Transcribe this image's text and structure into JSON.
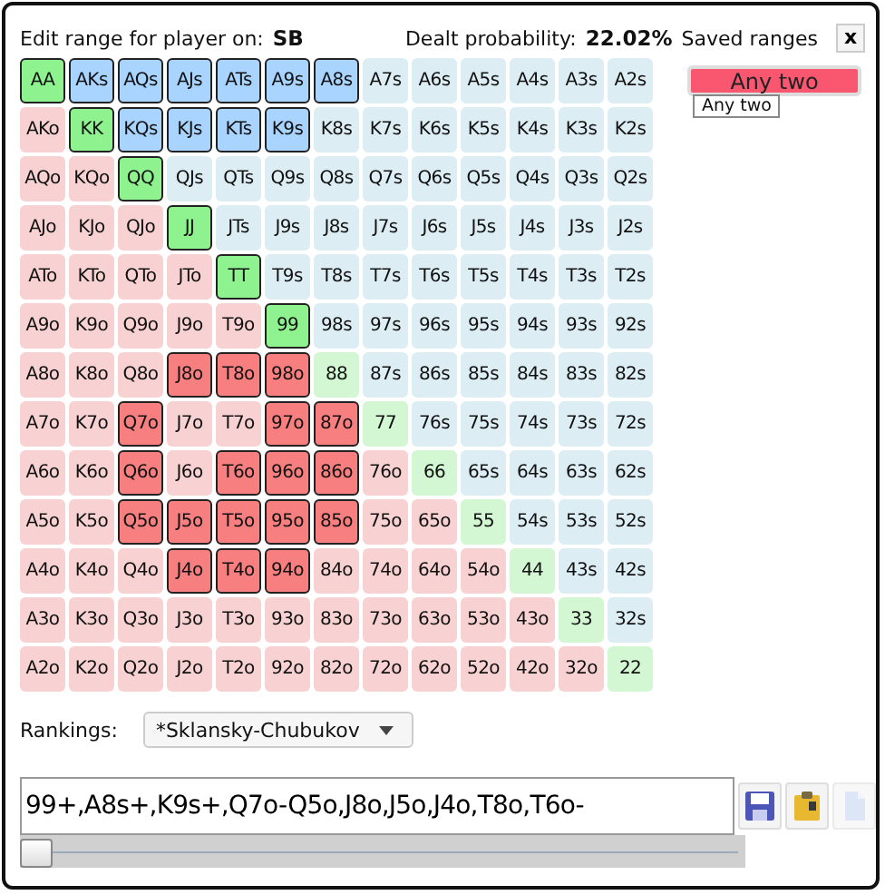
{
  "header": {
    "label": "Edit range for player on:",
    "player": "SB",
    "probability_label": "Dealt probability:",
    "probability": "22.02%"
  },
  "saved_ranges": {
    "title": "Saved ranges",
    "close": "x",
    "items": [
      {
        "label": "Any two"
      }
    ],
    "tooltip": "Any two"
  },
  "grid": [
    [
      {
        "label": "AA",
        "selected": true
      },
      {
        "label": "AKs",
        "selected": true
      },
      {
        "label": "AQs",
        "selected": true
      },
      {
        "label": "AJs",
        "selected": true
      },
      {
        "label": "ATs",
        "selected": true
      },
      {
        "label": "A9s",
        "selected": true
      },
      {
        "label": "A8s",
        "selected": true
      },
      {
        "label": "A7s",
        "selected": false
      },
      {
        "label": "A6s",
        "selected": false
      },
      {
        "label": "A5s",
        "selected": false
      },
      {
        "label": "A4s",
        "selected": false
      },
      {
        "label": "A3s",
        "selected": false
      },
      {
        "label": "A2s",
        "selected": false
      }
    ],
    [
      {
        "label": "AKo",
        "selected": false
      },
      {
        "label": "KK",
        "selected": true
      },
      {
        "label": "KQs",
        "selected": true
      },
      {
        "label": "KJs",
        "selected": true
      },
      {
        "label": "KTs",
        "selected": true
      },
      {
        "label": "K9s",
        "selected": true
      },
      {
        "label": "K8s",
        "selected": false
      },
      {
        "label": "K7s",
        "selected": false
      },
      {
        "label": "K6s",
        "selected": false
      },
      {
        "label": "K5s",
        "selected": false
      },
      {
        "label": "K4s",
        "selected": false
      },
      {
        "label": "K3s",
        "selected": false
      },
      {
        "label": "K2s",
        "selected": false
      }
    ],
    [
      {
        "label": "AQo",
        "selected": false
      },
      {
        "label": "KQo",
        "selected": false
      },
      {
        "label": "QQ",
        "selected": true
      },
      {
        "label": "QJs",
        "selected": false
      },
      {
        "label": "QTs",
        "selected": false
      },
      {
        "label": "Q9s",
        "selected": false
      },
      {
        "label": "Q8s",
        "selected": false
      },
      {
        "label": "Q7s",
        "selected": false
      },
      {
        "label": "Q6s",
        "selected": false
      },
      {
        "label": "Q5s",
        "selected": false
      },
      {
        "label": "Q4s",
        "selected": false
      },
      {
        "label": "Q3s",
        "selected": false
      },
      {
        "label": "Q2s",
        "selected": false
      }
    ],
    [
      {
        "label": "AJo",
        "selected": false
      },
      {
        "label": "KJo",
        "selected": false
      },
      {
        "label": "QJo",
        "selected": false
      },
      {
        "label": "JJ",
        "selected": true
      },
      {
        "label": "JTs",
        "selected": false
      },
      {
        "label": "J9s",
        "selected": false
      },
      {
        "label": "J8s",
        "selected": false
      },
      {
        "label": "J7s",
        "selected": false
      },
      {
        "label": "J6s",
        "selected": false
      },
      {
        "label": "J5s",
        "selected": false
      },
      {
        "label": "J4s",
        "selected": false
      },
      {
        "label": "J3s",
        "selected": false
      },
      {
        "label": "J2s",
        "selected": false
      }
    ],
    [
      {
        "label": "ATo",
        "selected": false
      },
      {
        "label": "KTo",
        "selected": false
      },
      {
        "label": "QTo",
        "selected": false
      },
      {
        "label": "JTo",
        "selected": false
      },
      {
        "label": "TT",
        "selected": true
      },
      {
        "label": "T9s",
        "selected": false
      },
      {
        "label": "T8s",
        "selected": false
      },
      {
        "label": "T7s",
        "selected": false
      },
      {
        "label": "T6s",
        "selected": false
      },
      {
        "label": "T5s",
        "selected": false
      },
      {
        "label": "T4s",
        "selected": false
      },
      {
        "label": "T3s",
        "selected": false
      },
      {
        "label": "T2s",
        "selected": false
      }
    ],
    [
      {
        "label": "A9o",
        "selected": false
      },
      {
        "label": "K9o",
        "selected": false
      },
      {
        "label": "Q9o",
        "selected": false
      },
      {
        "label": "J9o",
        "selected": false
      },
      {
        "label": "T9o",
        "selected": false
      },
      {
        "label": "99",
        "selected": true
      },
      {
        "label": "98s",
        "selected": false
      },
      {
        "label": "97s",
        "selected": false
      },
      {
        "label": "96s",
        "selected": false
      },
      {
        "label": "95s",
        "selected": false
      },
      {
        "label": "94s",
        "selected": false
      },
      {
        "label": "93s",
        "selected": false
      },
      {
        "label": "92s",
        "selected": false
      }
    ],
    [
      {
        "label": "A8o",
        "selected": false
      },
      {
        "label": "K8o",
        "selected": false
      },
      {
        "label": "Q8o",
        "selected": false
      },
      {
        "label": "J8o",
        "selected": true
      },
      {
        "label": "T8o",
        "selected": true
      },
      {
        "label": "98o",
        "selected": true
      },
      {
        "label": "88",
        "selected": false
      },
      {
        "label": "87s",
        "selected": false
      },
      {
        "label": "86s",
        "selected": false
      },
      {
        "label": "85s",
        "selected": false
      },
      {
        "label": "84s",
        "selected": false
      },
      {
        "label": "83s",
        "selected": false
      },
      {
        "label": "82s",
        "selected": false
      }
    ],
    [
      {
        "label": "A7o",
        "selected": false
      },
      {
        "label": "K7o",
        "selected": false
      },
      {
        "label": "Q7o",
        "selected": true
      },
      {
        "label": "J7o",
        "selected": false
      },
      {
        "label": "T7o",
        "selected": false
      },
      {
        "label": "97o",
        "selected": true
      },
      {
        "label": "87o",
        "selected": true
      },
      {
        "label": "77",
        "selected": false
      },
      {
        "label": "76s",
        "selected": false
      },
      {
        "label": "75s",
        "selected": false
      },
      {
        "label": "74s",
        "selected": false
      },
      {
        "label": "73s",
        "selected": false
      },
      {
        "label": "72s",
        "selected": false
      }
    ],
    [
      {
        "label": "A6o",
        "selected": false
      },
      {
        "label": "K6o",
        "selected": false
      },
      {
        "label": "Q6o",
        "selected": true
      },
      {
        "label": "J6o",
        "selected": false
      },
      {
        "label": "T6o",
        "selected": true
      },
      {
        "label": "96o",
        "selected": true
      },
      {
        "label": "86o",
        "selected": true
      },
      {
        "label": "76o",
        "selected": false
      },
      {
        "label": "66",
        "selected": false
      },
      {
        "label": "65s",
        "selected": false
      },
      {
        "label": "64s",
        "selected": false
      },
      {
        "label": "63s",
        "selected": false
      },
      {
        "label": "62s",
        "selected": false
      }
    ],
    [
      {
        "label": "A5o",
        "selected": false
      },
      {
        "label": "K5o",
        "selected": false
      },
      {
        "label": "Q5o",
        "selected": true
      },
      {
        "label": "J5o",
        "selected": true
      },
      {
        "label": "T5o",
        "selected": true
      },
      {
        "label": "95o",
        "selected": true
      },
      {
        "label": "85o",
        "selected": true
      },
      {
        "label": "75o",
        "selected": false
      },
      {
        "label": "65o",
        "selected": false
      },
      {
        "label": "55",
        "selected": false
      },
      {
        "label": "54s",
        "selected": false
      },
      {
        "label": "53s",
        "selected": false
      },
      {
        "label": "52s",
        "selected": false
      }
    ],
    [
      {
        "label": "A4o",
        "selected": false
      },
      {
        "label": "K4o",
        "selected": false
      },
      {
        "label": "Q4o",
        "selected": false
      },
      {
        "label": "J4o",
        "selected": true
      },
      {
        "label": "T4o",
        "selected": true
      },
      {
        "label": "94o",
        "selected": true
      },
      {
        "label": "84o",
        "selected": false
      },
      {
        "label": "74o",
        "selected": false
      },
      {
        "label": "64o",
        "selected": false
      },
      {
        "label": "54o",
        "selected": false
      },
      {
        "label": "44",
        "selected": false
      },
      {
        "label": "43s",
        "selected": false
      },
      {
        "label": "42s",
        "selected": false
      }
    ],
    [
      {
        "label": "A3o",
        "selected": false
      },
      {
        "label": "K3o",
        "selected": false
      },
      {
        "label": "Q3o",
        "selected": false
      },
      {
        "label": "J3o",
        "selected": false
      },
      {
        "label": "T3o",
        "selected": false
      },
      {
        "label": "93o",
        "selected": false
      },
      {
        "label": "83o",
        "selected": false
      },
      {
        "label": "73o",
        "selected": false
      },
      {
        "label": "63o",
        "selected": false
      },
      {
        "label": "53o",
        "selected": false
      },
      {
        "label": "43o",
        "selected": false
      },
      {
        "label": "33",
        "selected": false
      },
      {
        "label": "32s",
        "selected": false
      }
    ],
    [
      {
        "label": "A2o",
        "selected": false
      },
      {
        "label": "K2o",
        "selected": false
      },
      {
        "label": "Q2o",
        "selected": false
      },
      {
        "label": "J2o",
        "selected": false
      },
      {
        "label": "T2o",
        "selected": false
      },
      {
        "label": "92o",
        "selected": false
      },
      {
        "label": "82o",
        "selected": false
      },
      {
        "label": "72o",
        "selected": false
      },
      {
        "label": "62o",
        "selected": false
      },
      {
        "label": "52o",
        "selected": false
      },
      {
        "label": "42o",
        "selected": false
      },
      {
        "label": "32o",
        "selected": false
      },
      {
        "label": "22",
        "selected": false
      }
    ]
  ],
  "rankings": {
    "label": "Rankings:",
    "value": "*Sklansky-Chubukov"
  },
  "range_text": {
    "value": "99+,A8s+,K9s+,Q7o-Q5o,J8o,J5o,J4o,T8o,T6o-"
  },
  "tools": [
    {
      "kind": "save",
      "disabled": false
    },
    {
      "kind": "paste",
      "disabled": false
    },
    {
      "kind": "copy",
      "disabled": true
    }
  ],
  "slider": {
    "level": 0.0
  }
}
